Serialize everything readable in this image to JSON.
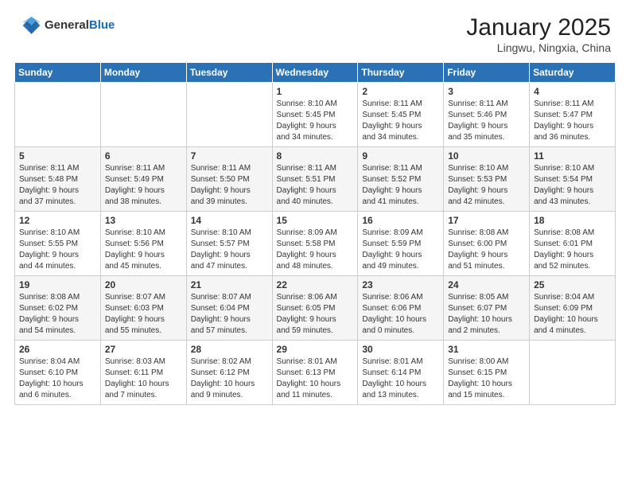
{
  "header": {
    "logo_general": "General",
    "logo_blue": "Blue",
    "month": "January 2025",
    "location": "Lingwu, Ningxia, China"
  },
  "weekdays": [
    "Sunday",
    "Monday",
    "Tuesday",
    "Wednesday",
    "Thursday",
    "Friday",
    "Saturday"
  ],
  "weeks": [
    [
      {
        "day": "",
        "info": ""
      },
      {
        "day": "",
        "info": ""
      },
      {
        "day": "",
        "info": ""
      },
      {
        "day": "1",
        "info": "Sunrise: 8:10 AM\nSunset: 5:45 PM\nDaylight: 9 hours\nand 34 minutes."
      },
      {
        "day": "2",
        "info": "Sunrise: 8:11 AM\nSunset: 5:45 PM\nDaylight: 9 hours\nand 34 minutes."
      },
      {
        "day": "3",
        "info": "Sunrise: 8:11 AM\nSunset: 5:46 PM\nDaylight: 9 hours\nand 35 minutes."
      },
      {
        "day": "4",
        "info": "Sunrise: 8:11 AM\nSunset: 5:47 PM\nDaylight: 9 hours\nand 36 minutes."
      }
    ],
    [
      {
        "day": "5",
        "info": "Sunrise: 8:11 AM\nSunset: 5:48 PM\nDaylight: 9 hours\nand 37 minutes."
      },
      {
        "day": "6",
        "info": "Sunrise: 8:11 AM\nSunset: 5:49 PM\nDaylight: 9 hours\nand 38 minutes."
      },
      {
        "day": "7",
        "info": "Sunrise: 8:11 AM\nSunset: 5:50 PM\nDaylight: 9 hours\nand 39 minutes."
      },
      {
        "day": "8",
        "info": "Sunrise: 8:11 AM\nSunset: 5:51 PM\nDaylight: 9 hours\nand 40 minutes."
      },
      {
        "day": "9",
        "info": "Sunrise: 8:11 AM\nSunset: 5:52 PM\nDaylight: 9 hours\nand 41 minutes."
      },
      {
        "day": "10",
        "info": "Sunrise: 8:10 AM\nSunset: 5:53 PM\nDaylight: 9 hours\nand 42 minutes."
      },
      {
        "day": "11",
        "info": "Sunrise: 8:10 AM\nSunset: 5:54 PM\nDaylight: 9 hours\nand 43 minutes."
      }
    ],
    [
      {
        "day": "12",
        "info": "Sunrise: 8:10 AM\nSunset: 5:55 PM\nDaylight: 9 hours\nand 44 minutes."
      },
      {
        "day": "13",
        "info": "Sunrise: 8:10 AM\nSunset: 5:56 PM\nDaylight: 9 hours\nand 45 minutes."
      },
      {
        "day": "14",
        "info": "Sunrise: 8:10 AM\nSunset: 5:57 PM\nDaylight: 9 hours\nand 47 minutes."
      },
      {
        "day": "15",
        "info": "Sunrise: 8:09 AM\nSunset: 5:58 PM\nDaylight: 9 hours\nand 48 minutes."
      },
      {
        "day": "16",
        "info": "Sunrise: 8:09 AM\nSunset: 5:59 PM\nDaylight: 9 hours\nand 49 minutes."
      },
      {
        "day": "17",
        "info": "Sunrise: 8:08 AM\nSunset: 6:00 PM\nDaylight: 9 hours\nand 51 minutes."
      },
      {
        "day": "18",
        "info": "Sunrise: 8:08 AM\nSunset: 6:01 PM\nDaylight: 9 hours\nand 52 minutes."
      }
    ],
    [
      {
        "day": "19",
        "info": "Sunrise: 8:08 AM\nSunset: 6:02 PM\nDaylight: 9 hours\nand 54 minutes."
      },
      {
        "day": "20",
        "info": "Sunrise: 8:07 AM\nSunset: 6:03 PM\nDaylight: 9 hours\nand 55 minutes."
      },
      {
        "day": "21",
        "info": "Sunrise: 8:07 AM\nSunset: 6:04 PM\nDaylight: 9 hours\nand 57 minutes."
      },
      {
        "day": "22",
        "info": "Sunrise: 8:06 AM\nSunset: 6:05 PM\nDaylight: 9 hours\nand 59 minutes."
      },
      {
        "day": "23",
        "info": "Sunrise: 8:06 AM\nSunset: 6:06 PM\nDaylight: 10 hours\nand 0 minutes."
      },
      {
        "day": "24",
        "info": "Sunrise: 8:05 AM\nSunset: 6:07 PM\nDaylight: 10 hours\nand 2 minutes."
      },
      {
        "day": "25",
        "info": "Sunrise: 8:04 AM\nSunset: 6:09 PM\nDaylight: 10 hours\nand 4 minutes."
      }
    ],
    [
      {
        "day": "26",
        "info": "Sunrise: 8:04 AM\nSunset: 6:10 PM\nDaylight: 10 hours\nand 6 minutes."
      },
      {
        "day": "27",
        "info": "Sunrise: 8:03 AM\nSunset: 6:11 PM\nDaylight: 10 hours\nand 7 minutes."
      },
      {
        "day": "28",
        "info": "Sunrise: 8:02 AM\nSunset: 6:12 PM\nDaylight: 10 hours\nand 9 minutes."
      },
      {
        "day": "29",
        "info": "Sunrise: 8:01 AM\nSunset: 6:13 PM\nDaylight: 10 hours\nand 11 minutes."
      },
      {
        "day": "30",
        "info": "Sunrise: 8:01 AM\nSunset: 6:14 PM\nDaylight: 10 hours\nand 13 minutes."
      },
      {
        "day": "31",
        "info": "Sunrise: 8:00 AM\nSunset: 6:15 PM\nDaylight: 10 hours\nand 15 minutes."
      },
      {
        "day": "",
        "info": ""
      }
    ]
  ]
}
